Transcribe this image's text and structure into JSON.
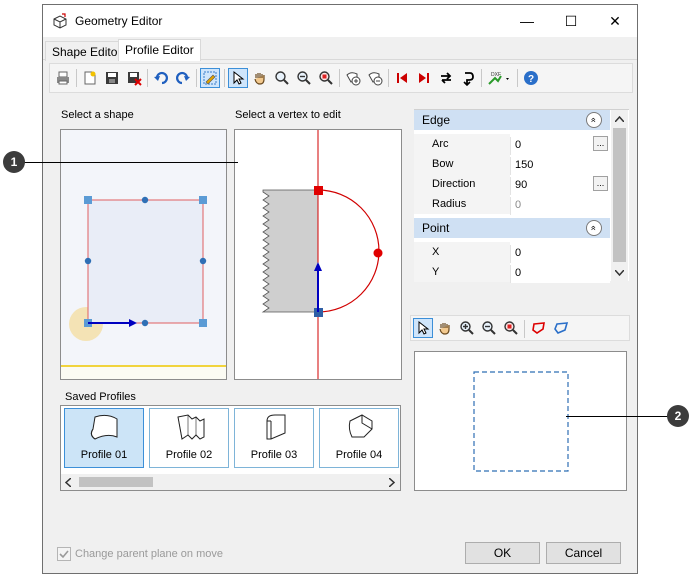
{
  "window": {
    "title": "Geometry Editor",
    "minimize_glyph": "—",
    "maximize_glyph": "☐",
    "close_glyph": "✕"
  },
  "tabs": [
    {
      "label": "Shape Editor"
    },
    {
      "label": "Profile Editor"
    }
  ],
  "active_tab": "Profile Editor",
  "panels": {
    "select_shape_label": "Select a shape",
    "select_vertex_label": "Select a vertex to edit",
    "saved_profiles_label": "Saved Profiles"
  },
  "property_grid": {
    "edge_header": "Edge",
    "point_header": "Point",
    "ellipsis": "...",
    "collapse_glyph": "«",
    "edge_rows": [
      {
        "name": "Arc",
        "value": "0",
        "readonly": false,
        "ellipsis": true
      },
      {
        "name": "Bow",
        "value": "150",
        "readonly": false,
        "ellipsis": false
      },
      {
        "name": "Direction",
        "value": "90",
        "readonly": false,
        "ellipsis": true
      },
      {
        "name": "Radius",
        "value": "0",
        "readonly": true,
        "ellipsis": false
      }
    ],
    "point_rows": [
      {
        "name": "X",
        "value": "0"
      },
      {
        "name": "Y",
        "value": "0"
      }
    ]
  },
  "saved_profiles": [
    {
      "label": "Profile 01",
      "selected": true
    },
    {
      "label": "Profile 02",
      "selected": false
    },
    {
      "label": "Profile 03",
      "selected": false
    },
    {
      "label": "Profile 04",
      "selected": false
    }
  ],
  "footer": {
    "checkbox_label": "Change parent plane on move",
    "ok_label": "OK",
    "cancel_label": "Cancel"
  },
  "callouts": {
    "one": "1",
    "two": "2"
  },
  "colors": {
    "accent": "#3c8fd8",
    "shape_outline": "#e06060",
    "vertex_handle": "#5b9bd5",
    "arc_red": "#d10000",
    "arrow_blue": "#0000c0"
  }
}
